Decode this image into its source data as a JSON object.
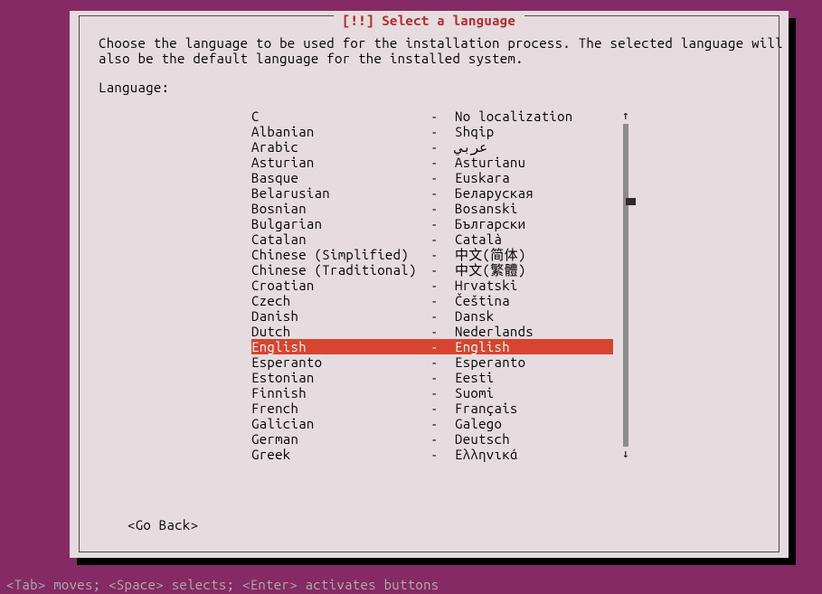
{
  "colors": {
    "magenta": "#852a65",
    "panel": "#e6dbde",
    "title_red": "#b22f2f",
    "highlight": "#d8452f"
  },
  "dialog": {
    "title": "[!!] Select a language",
    "instructions_line1": "Choose the language to be used for the installation process. The selected language will",
    "instructions_line2": "also be the default language for the installed system.",
    "label": "Language:",
    "selected_index": 15,
    "go_back": "<Go Back>",
    "languages": [
      {
        "name": "C",
        "native": "No localization"
      },
      {
        "name": "Albanian",
        "native": "Shqip"
      },
      {
        "name": "Arabic",
        "native": "عربي"
      },
      {
        "name": "Asturian",
        "native": "Asturianu"
      },
      {
        "name": "Basque",
        "native": "Euskara"
      },
      {
        "name": "Belarusian",
        "native": "Беларуская"
      },
      {
        "name": "Bosnian",
        "native": "Bosanski"
      },
      {
        "name": "Bulgarian",
        "native": "Български"
      },
      {
        "name": "Catalan",
        "native": "Català"
      },
      {
        "name": "Chinese (Simplified)",
        "native": "中文(简体)"
      },
      {
        "name": "Chinese (Traditional)",
        "native": "中文(繁體)"
      },
      {
        "name": "Croatian",
        "native": "Hrvatski"
      },
      {
        "name": "Czech",
        "native": "Čeština"
      },
      {
        "name": "Danish",
        "native": "Dansk"
      },
      {
        "name": "Dutch",
        "native": "Nederlands"
      },
      {
        "name": "English",
        "native": "English"
      },
      {
        "name": "Esperanto",
        "native": "Esperanto"
      },
      {
        "name": "Estonian",
        "native": "Eesti"
      },
      {
        "name": "Finnish",
        "native": "Suomi"
      },
      {
        "name": "French",
        "native": "Français"
      },
      {
        "name": "Galician",
        "native": "Galego"
      },
      {
        "name": "German",
        "native": "Deutsch"
      },
      {
        "name": "Greek",
        "native": "Ελληνικά"
      }
    ],
    "scroll": {
      "thumb_percent": 23
    }
  },
  "footer": {
    "hint": "<Tab> moves; <Space> selects; <Enter> activates buttons"
  }
}
